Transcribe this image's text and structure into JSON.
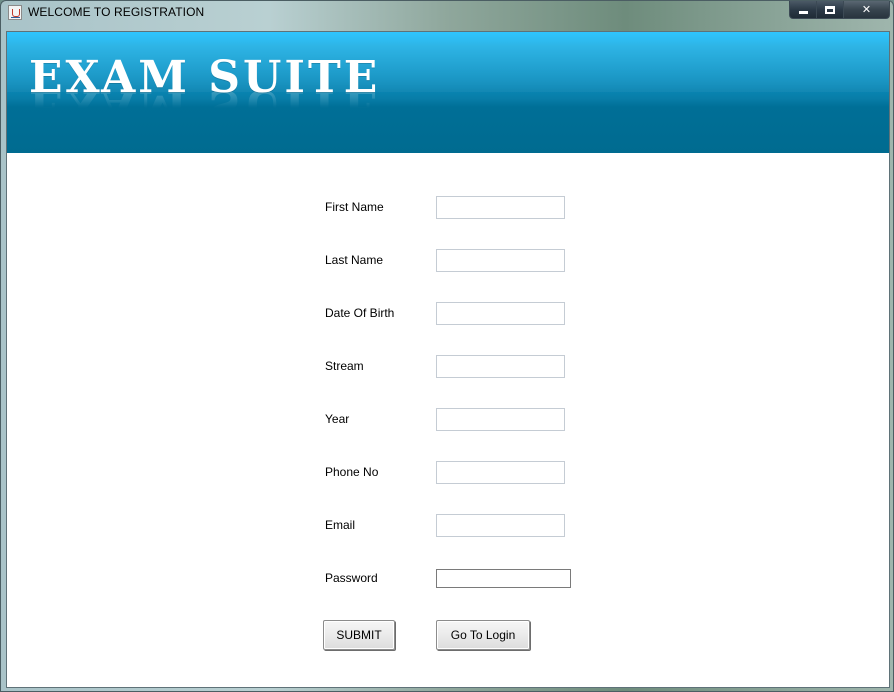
{
  "window": {
    "title": "WELCOME TO REGISTRATION",
    "controls": {
      "minimize": "minimize",
      "maximize": "maximize",
      "close": "close"
    }
  },
  "banner": {
    "title": "EXAM SUITE",
    "colors": {
      "top": "#00b8ff",
      "bottom": "#006b90"
    }
  },
  "form": {
    "fields": [
      {
        "label": "First Name",
        "value": "",
        "placeholder": ""
      },
      {
        "label": "Last Name",
        "value": "",
        "placeholder": ""
      },
      {
        "label": "Date Of Birth",
        "value": "",
        "placeholder": ""
      },
      {
        "label": "Stream",
        "value": "",
        "placeholder": ""
      },
      {
        "label": "Year",
        "value": "",
        "placeholder": ""
      },
      {
        "label": "Phone No",
        "value": "",
        "placeholder": ""
      },
      {
        "label": "Email",
        "value": "",
        "placeholder": ""
      },
      {
        "label": "Password",
        "value": "",
        "placeholder": ""
      }
    ],
    "submit_label": "SUBMIT",
    "login_label": "Go To Login"
  }
}
